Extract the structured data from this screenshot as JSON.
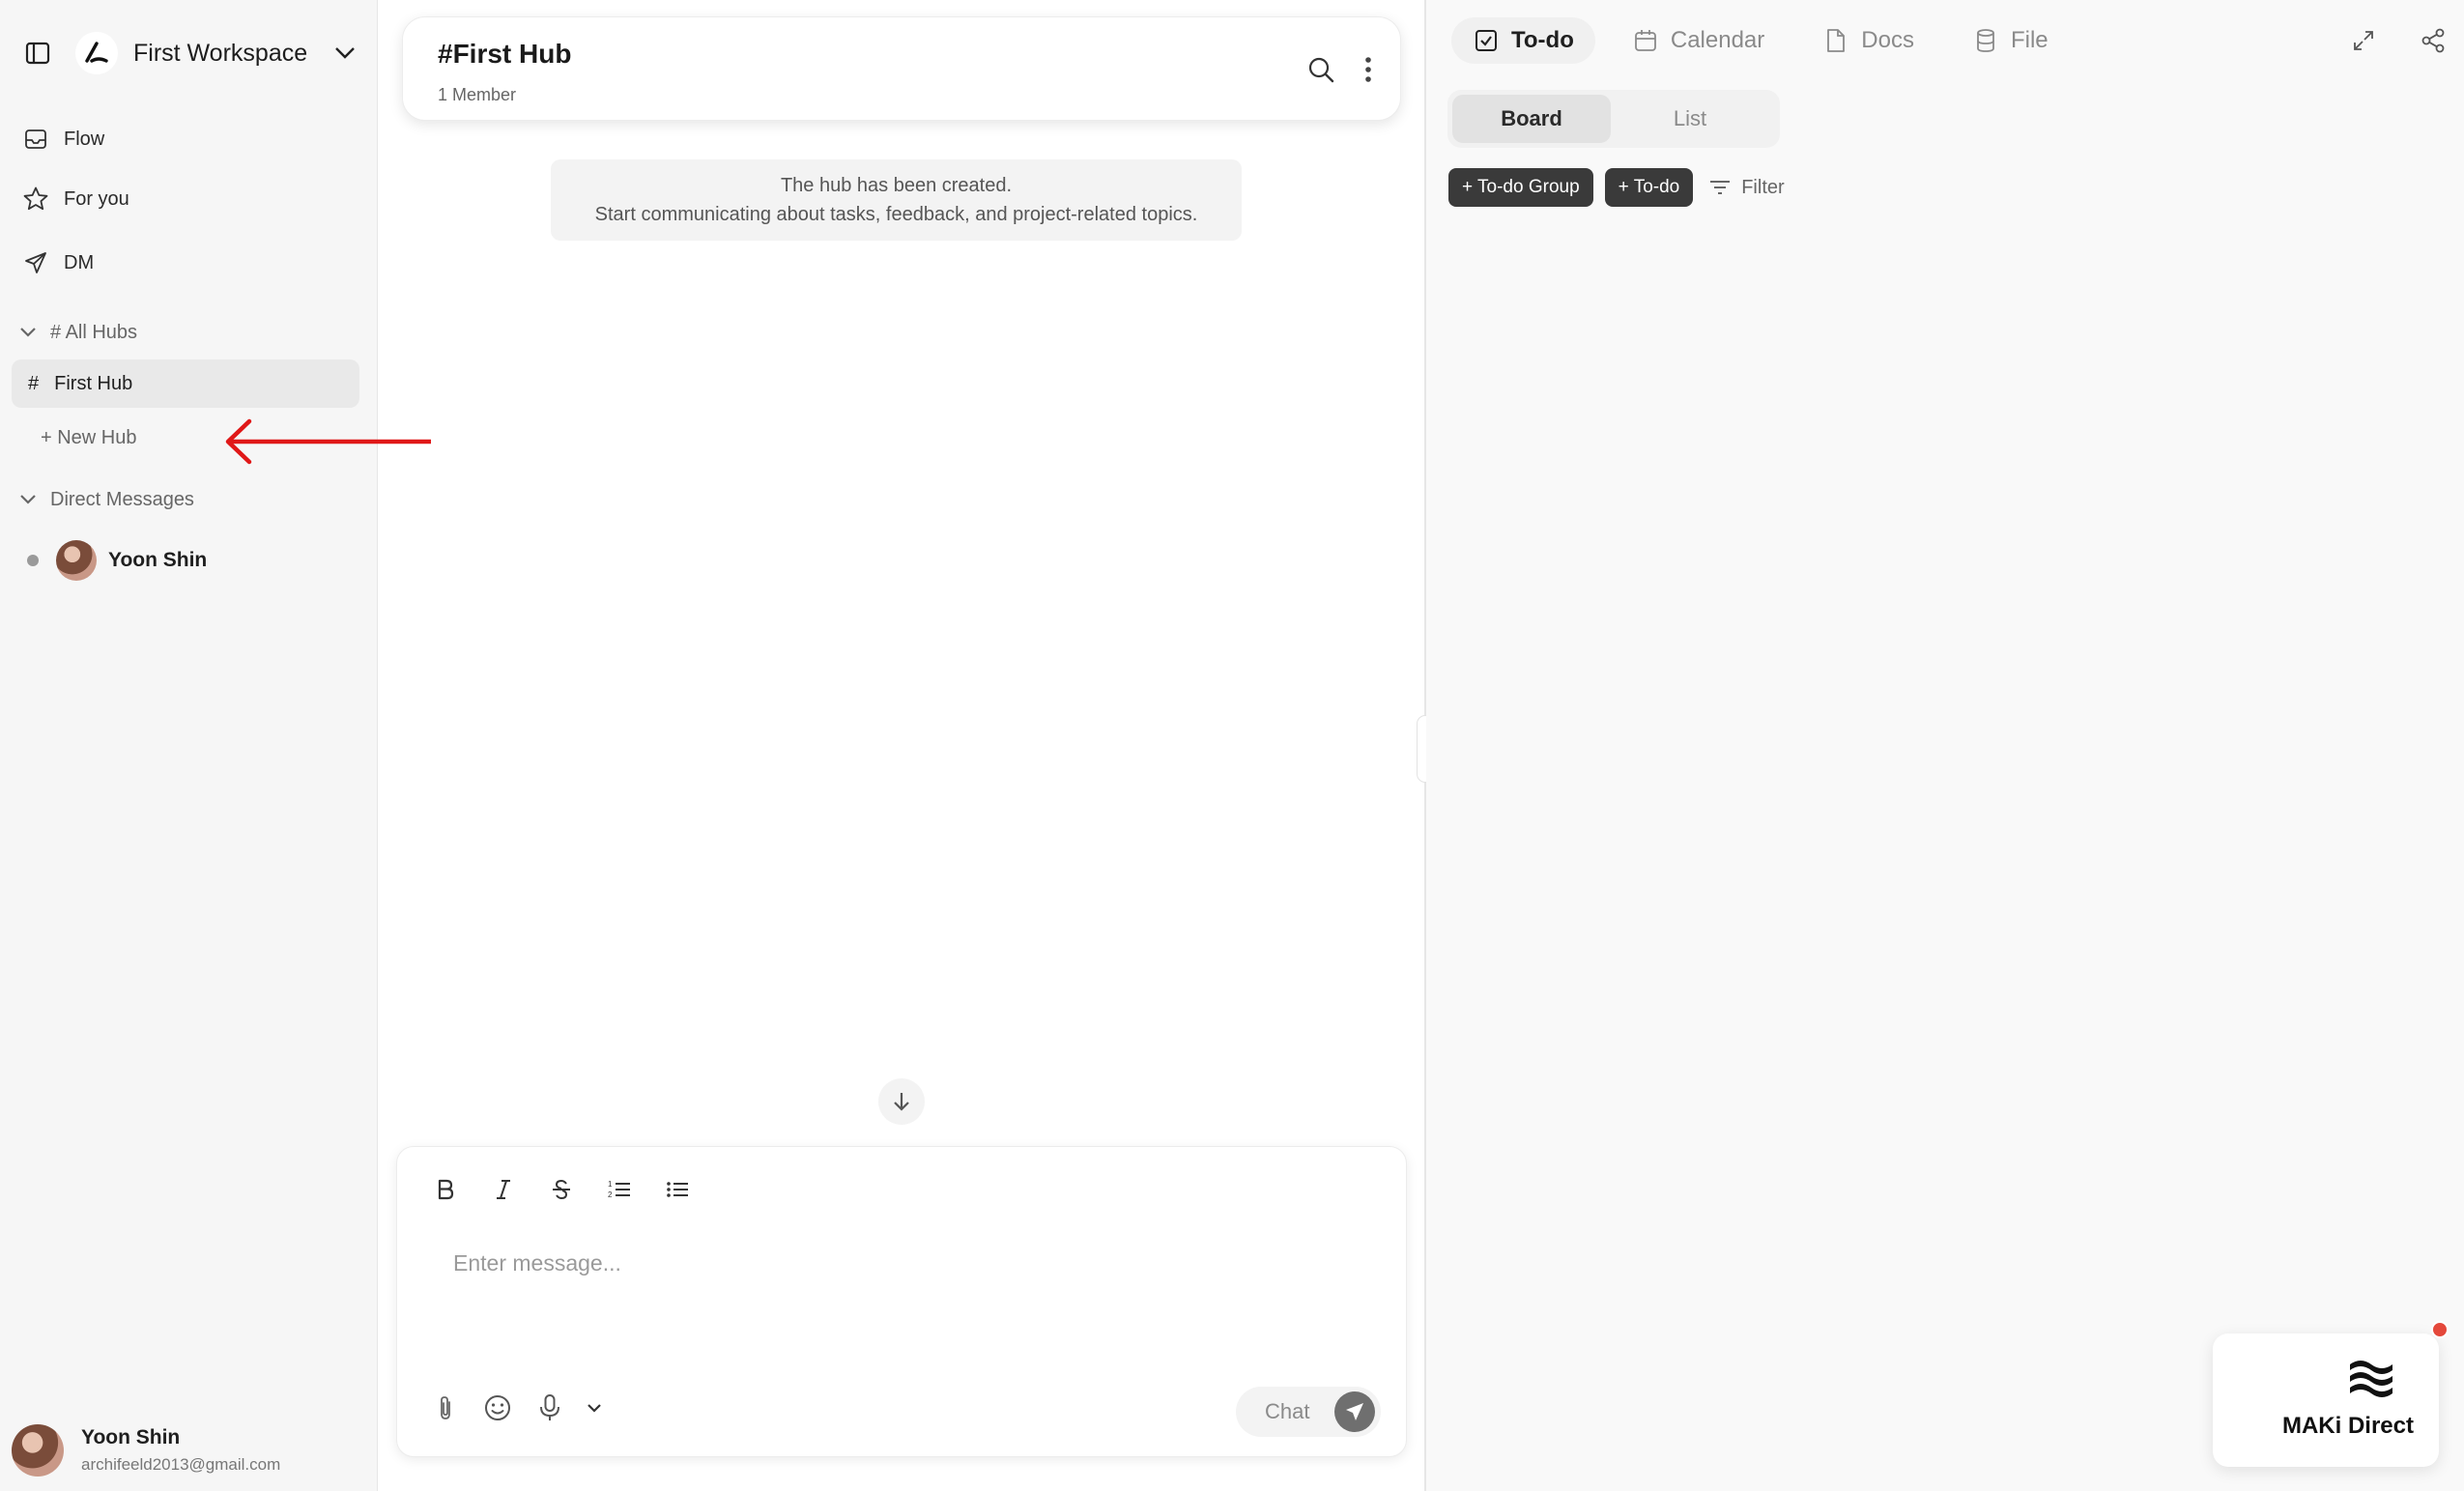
{
  "sidebar": {
    "workspace_name": "First Workspace",
    "nav": [
      {
        "label": "Flow",
        "icon": "inbox-icon"
      },
      {
        "label": "For you",
        "icon": "star-icon"
      },
      {
        "label": "DM",
        "icon": "send-icon"
      }
    ],
    "hubs_section": "# All Hubs",
    "active_hub": "First Hub",
    "active_hub_prefix": "#",
    "new_hub": "+ New Hub",
    "dm_section": "Direct Messages",
    "dm_contact": "Yoon Shin",
    "profile": {
      "name": "Yoon Shin",
      "email": "archifeeld2013@gmail.com"
    }
  },
  "chat": {
    "title": "#First Hub",
    "members": "1 Member",
    "system_message_line1": "The hub has been created.",
    "system_message_line2": "Start communicating about tasks, feedback, and project-related topics.",
    "input_placeholder": "Enter message...",
    "send_label": "Chat"
  },
  "right_panel": {
    "tabs": [
      {
        "label": "To-do",
        "icon": "checkbox-icon",
        "active": true
      },
      {
        "label": "Calendar",
        "icon": "calendar-icon",
        "active": false
      },
      {
        "label": "Docs",
        "icon": "document-icon",
        "active": false
      },
      {
        "label": "File",
        "icon": "database-icon",
        "active": false
      }
    ],
    "views": [
      {
        "label": "Board",
        "active": true
      },
      {
        "label": "List",
        "active": false
      }
    ],
    "add_group": "+ To-do Group",
    "add_todo": "+ To-do",
    "filter": "Filter"
  },
  "widget": {
    "label": "MAKi Direct"
  },
  "colors": {
    "annotation_arrow": "#e01818",
    "notification_dot": "#e4483b",
    "dark_button": "#3a3a3a"
  }
}
